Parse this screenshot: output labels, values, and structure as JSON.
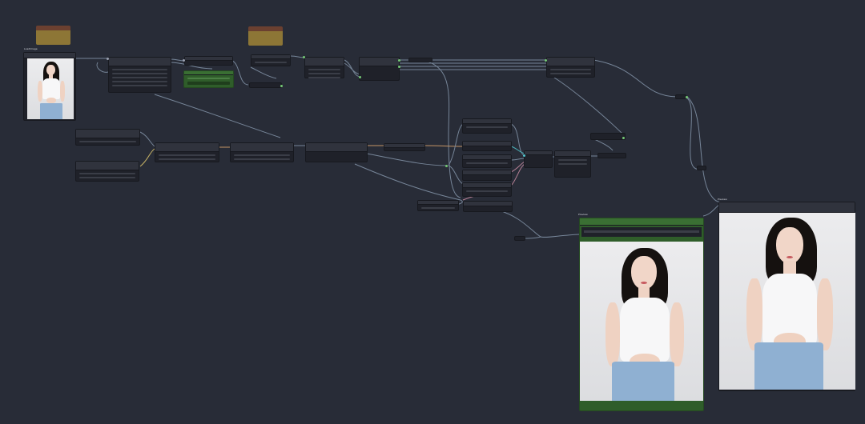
{
  "canvas": {
    "background": "#282c37",
    "link_color": "#7f8fa3",
    "accent_green": "#2f5d2a",
    "note_color": "#8d7636"
  },
  "nodes": {
    "load_image_title": "LoadImage",
    "preview_left_title": "Preview",
    "preview_right_title": "Preview",
    "output_node_title": "Save Image"
  },
  "icons": [
    "photo-thumbnail",
    "connection-dot"
  ]
}
